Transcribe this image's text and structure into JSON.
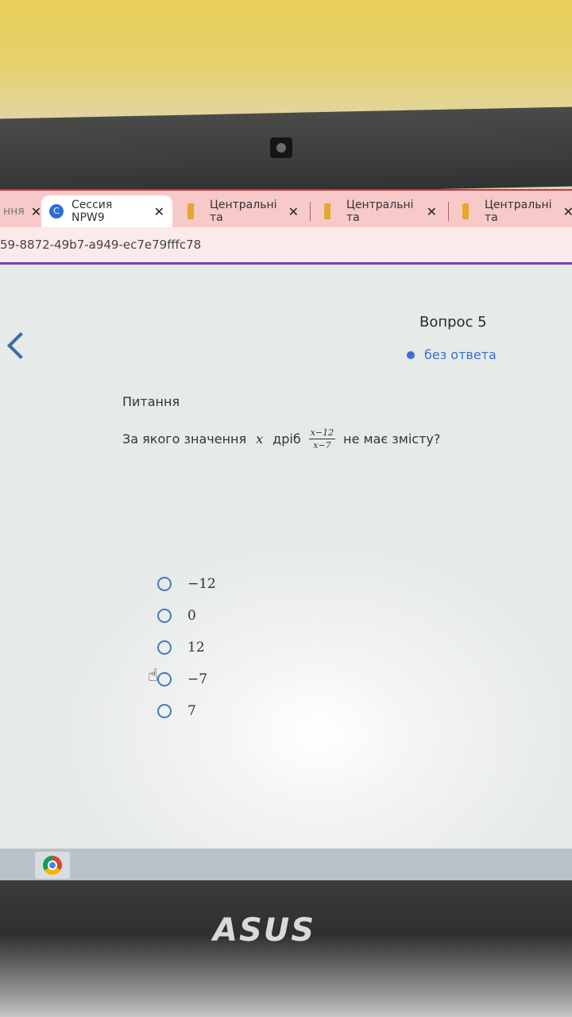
{
  "browser": {
    "tabs": [
      {
        "label": "ння",
        "icon": "document-icon"
      },
      {
        "label": "Сессия NPW9",
        "icon": "c-logo-icon",
        "active": true
      },
      {
        "label": "Центральні та",
        "icon": "flag-icon"
      },
      {
        "label": "Центральні та",
        "icon": "flag-icon"
      },
      {
        "label": "Центральні та",
        "icon": "flag-icon"
      }
    ],
    "close_glyph": "✕",
    "url_fragment": "59-8872-49b7-a949-ec7e79fffc78"
  },
  "quiz": {
    "question_number": "Вопрос 5",
    "status": "без ответа",
    "section_label": "Питання",
    "question_parts": {
      "before": "За якого значення",
      "variable": "x",
      "middle": "дріб",
      "numerator": "x−12",
      "denominator": "x−7",
      "after": "не має змісту?"
    },
    "options": [
      "−12",
      "0",
      "12",
      "−7",
      "7"
    ]
  },
  "laptop": {
    "brand": "ASUS"
  },
  "colors": {
    "accent": "#3a6fcf",
    "tab_bar": "#f7c9c9",
    "url_underline": "#7a3fb0"
  }
}
